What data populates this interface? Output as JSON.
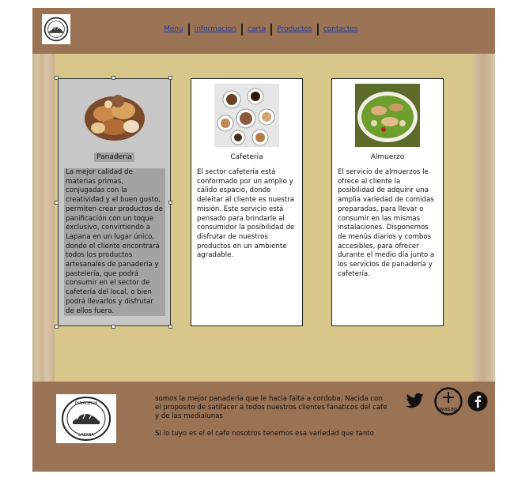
{
  "nav": {
    "items": [
      "Menu",
      "informacion",
      "carta",
      "Productos",
      "contactos"
    ]
  },
  "cards": [
    {
      "title": "Panaderia",
      "text": "La mejor calidad de materias primas, conjugadas con la creatividad y el buen gusto, permiten crear productos de panificación con un toque exclusivo, convirtiendo a Lapana en un lugar único, donde el cliente encontrará todos los productos artesanales de panadería y pastelería, que podrá consumir en el sector de cafetería del local, o bien podrá llevarlos y disfrutar de ellos fuera.",
      "image_icon": "pastries-photo"
    },
    {
      "title": "Cafeteria",
      "text": "El sector cafetería está conformado por un amplio y cálido espacio, donde deleitar al cliente es nuestra misión. Este servicio está pensado para brindarle al consumidor la posibilidad de disfrutar de nuestros productos en un ambiente agradable.",
      "image_icon": "coffee-cups-photo"
    },
    {
      "title": "Almuerzo",
      "text": "El servicio de almuerzos le ofrece al cliente la posibilidad de adquirir una amplia variedad de comidas preparadas, para llevar o consumir en las mismas instalaciones. Disponemos de menús diarios y combos accesibles, para ofrecer durante el medio día junto a los servicios de panadería y cafetería.",
      "image_icon": "salad-photo"
    }
  ],
  "footer": {
    "text1": "somos la mejor panaderia que le hacia falta a cordoba. Nacida con el proposito de satifacer a todos nuestros clientes fanaticos del cafe y de las medialunas",
    "text2": "Si lo tuyo es el el cafe nosotros tenemos esa variedad que tanto",
    "wasap_label": "wasap",
    "logo_text_top": "PANADERIA",
    "logo_text_bottom": "LAPANA"
  },
  "colors": {
    "brown": "#9a7254",
    "khaki": "#d7c78a",
    "link": "#1f3fa8"
  }
}
